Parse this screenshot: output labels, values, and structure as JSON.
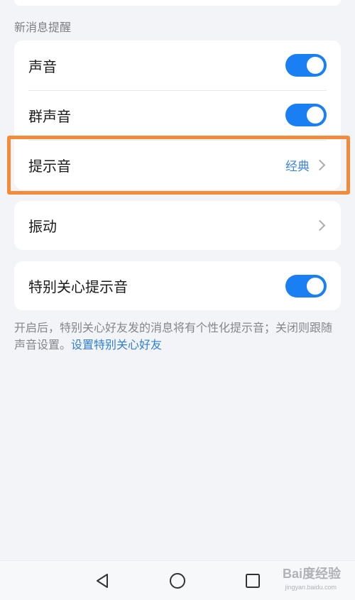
{
  "section": {
    "header": "新消息提醒"
  },
  "card_main": {
    "rows": [
      {
        "label": "声音",
        "toggle_on": true
      },
      {
        "label": "群声音",
        "toggle_on": true
      },
      {
        "label": "提示音",
        "value": "经典"
      }
    ]
  },
  "card_vibration": {
    "label": "振动"
  },
  "card_special": {
    "label": "特别关心提示音",
    "toggle_on": true
  },
  "note": {
    "text": "开启后，特别关心好友发的消息将有个性化提示音；关闭则跟随声音设置。",
    "link": "设置特别关心好友"
  },
  "watermark": {
    "text": "Bai度经验",
    "sub": "jingyan.baidu.com"
  },
  "colors": {
    "accent": "#1a7ff3",
    "link": "#2e7fd5",
    "highlight": "#f48b3a"
  }
}
